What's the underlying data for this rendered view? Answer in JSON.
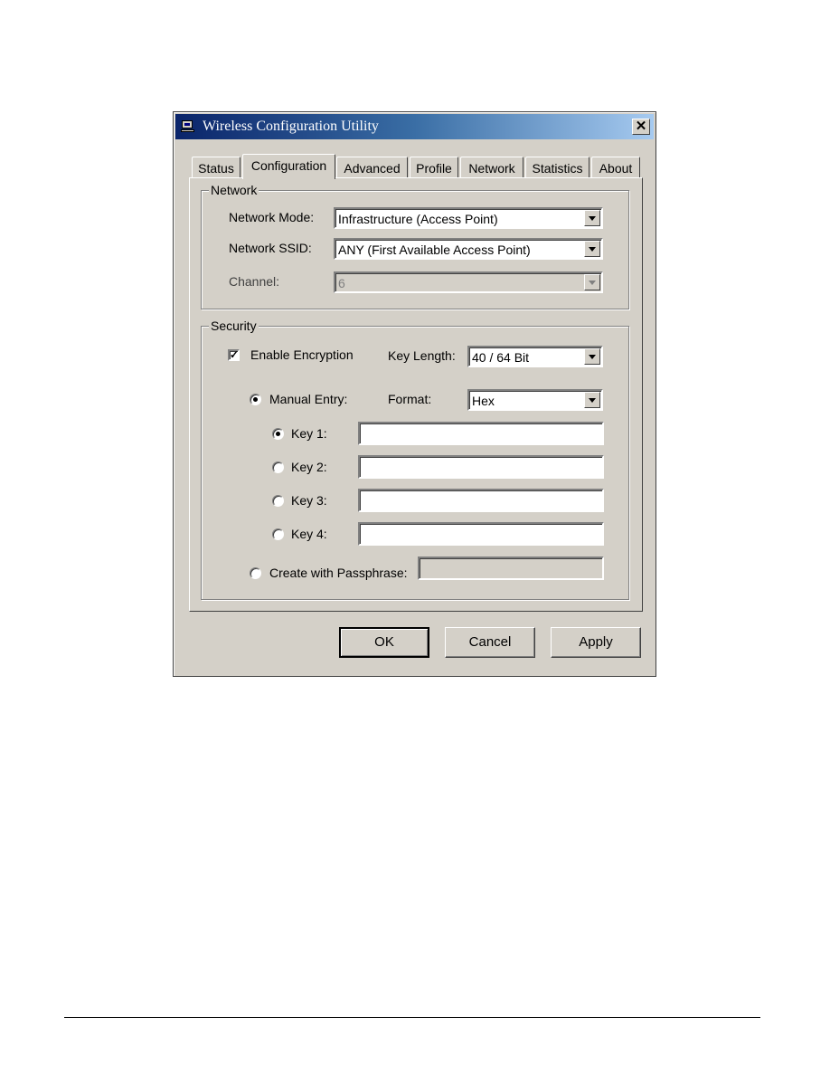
{
  "window": {
    "title": "Wireless Configuration Utility",
    "close_label": "✕"
  },
  "tabs": [
    {
      "label": "Status",
      "active": false
    },
    {
      "label": "Configuration",
      "active": true
    },
    {
      "label": "Advanced",
      "active": false
    },
    {
      "label": "Profile",
      "active": false
    },
    {
      "label": "Network",
      "active": false
    },
    {
      "label": "Statistics",
      "active": false
    },
    {
      "label": "About",
      "active": false
    }
  ],
  "network": {
    "group_label": "Network",
    "mode_label": "Network Mode:",
    "mode_value": "Infrastructure (Access Point)",
    "ssid_label": "Network SSID:",
    "ssid_value": "ANY (First Available Access Point)",
    "channel_label": "Channel:",
    "channel_value": "6"
  },
  "security": {
    "group_label": "Security",
    "enable_encryption_label": "Enable Encryption",
    "enable_encryption_checked": true,
    "key_length_label": "Key Length:",
    "key_length_value": "40 / 64 Bit",
    "manual_entry_label": "Manual Entry:",
    "manual_entry_selected": true,
    "format_label": "Format:",
    "format_value": "Hex",
    "keys": [
      {
        "label": "Key 1:",
        "value": "",
        "selected": true
      },
      {
        "label": "Key 2:",
        "value": "",
        "selected": false
      },
      {
        "label": "Key 3:",
        "value": "",
        "selected": false
      },
      {
        "label": "Key 4:",
        "value": "",
        "selected": false
      }
    ],
    "passphrase_label": "Create with Passphrase:",
    "passphrase_value": "",
    "passphrase_selected": false
  },
  "buttons": {
    "ok": "OK",
    "cancel": "Cancel",
    "apply": "Apply"
  }
}
